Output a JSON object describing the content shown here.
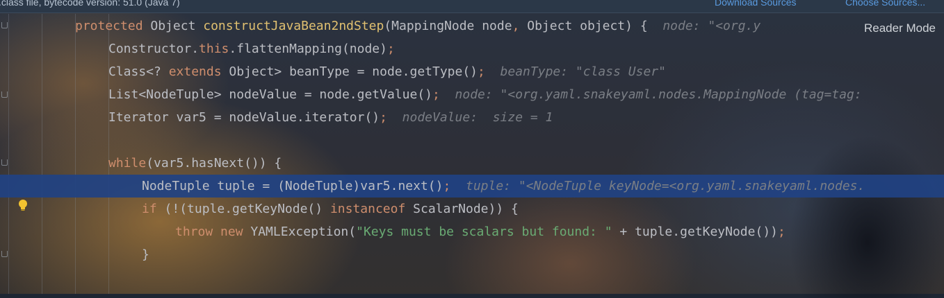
{
  "topbar": {
    "message": ".class file, bytecode version: 51.0 (Java 7)",
    "download_sources": "Download Sources",
    "choose_sources": "Choose Sources..."
  },
  "reader_mode": "Reader Mode",
  "editor": {
    "lines": [
      {
        "segments": [
          {
            "t": "protected",
            "c": "kw"
          },
          {
            "t": " Object "
          },
          {
            "t": "constructJavaBean2ndStep",
            "c": "fn"
          },
          {
            "t": "(MappingNode node"
          },
          {
            "t": ",",
            "c": "kw"
          },
          {
            "t": " Object object) {"
          },
          {
            "t": "  node: \"<org.y",
            "c": "hint"
          }
        ]
      },
      {
        "segments": [
          {
            "t": "Constructor."
          },
          {
            "t": "this",
            "c": "kw"
          },
          {
            "t": ".flattenMapping(node)"
          },
          {
            "t": ";",
            "c": "kw"
          }
        ]
      },
      {
        "segments": [
          {
            "t": "Class<? "
          },
          {
            "t": "extends",
            "c": "kw"
          },
          {
            "t": " Object> beanType = node.getType()"
          },
          {
            "t": ";",
            "c": "kw"
          },
          {
            "t": "  beanType: \"class User\"",
            "c": "hint"
          }
        ]
      },
      {
        "segments": [
          {
            "t": "List<NodeTuple> nodeValue = node.getValue()"
          },
          {
            "t": ";",
            "c": "kw"
          },
          {
            "t": "  node: \"<org.yaml.snakeyaml.nodes.MappingNode (tag=tag:",
            "c": "hint"
          }
        ]
      },
      {
        "segments": [
          {
            "t": "Iterator var5 = nodeValue.iterator()"
          },
          {
            "t": ";",
            "c": "kw"
          },
          {
            "t": "  nodeValue:  size = 1",
            "c": "hint"
          }
        ]
      },
      {
        "segments": []
      },
      {
        "segments": [
          {
            "t": "while",
            "c": "kw"
          },
          {
            "t": "(var5.hasNext()) {"
          }
        ]
      },
      {
        "segments": [
          {
            "t": "NodeTuple tuple = (NodeTuple)var5.next()"
          },
          {
            "t": ";",
            "c": "kw"
          },
          {
            "t": "  tuple: \"<NodeTuple keyNode=<org.yaml.snakeyaml.nodes.",
            "c": "hint"
          }
        ]
      },
      {
        "segments": [
          {
            "t": "if",
            "c": "kw"
          },
          {
            "t": " (!(tuple.getKeyNode() "
          },
          {
            "t": "instanceof",
            "c": "kw"
          },
          {
            "t": " ScalarNode)) {"
          }
        ]
      },
      {
        "segments": [
          {
            "t": "throw",
            "c": "kw"
          },
          {
            "t": " "
          },
          {
            "t": "new",
            "c": "kw"
          },
          {
            "t": " YAMLException("
          },
          {
            "t": "\"Keys must be scalars but found: \"",
            "c": "str"
          },
          {
            "t": " + tuple.getKeyNode())"
          },
          {
            "t": ";",
            "c": "kw"
          }
        ]
      },
      {
        "segments": [
          {
            "t": "}"
          }
        ]
      }
    ]
  },
  "icons": {
    "bulb": "lightbulb-icon",
    "fold": "fold-marker-icon"
  },
  "colors": {
    "keyword": "#cf8e6d",
    "method": "#e0c070",
    "string": "#6aab73",
    "hint": "#7a7e85",
    "highlight": "#214283"
  }
}
